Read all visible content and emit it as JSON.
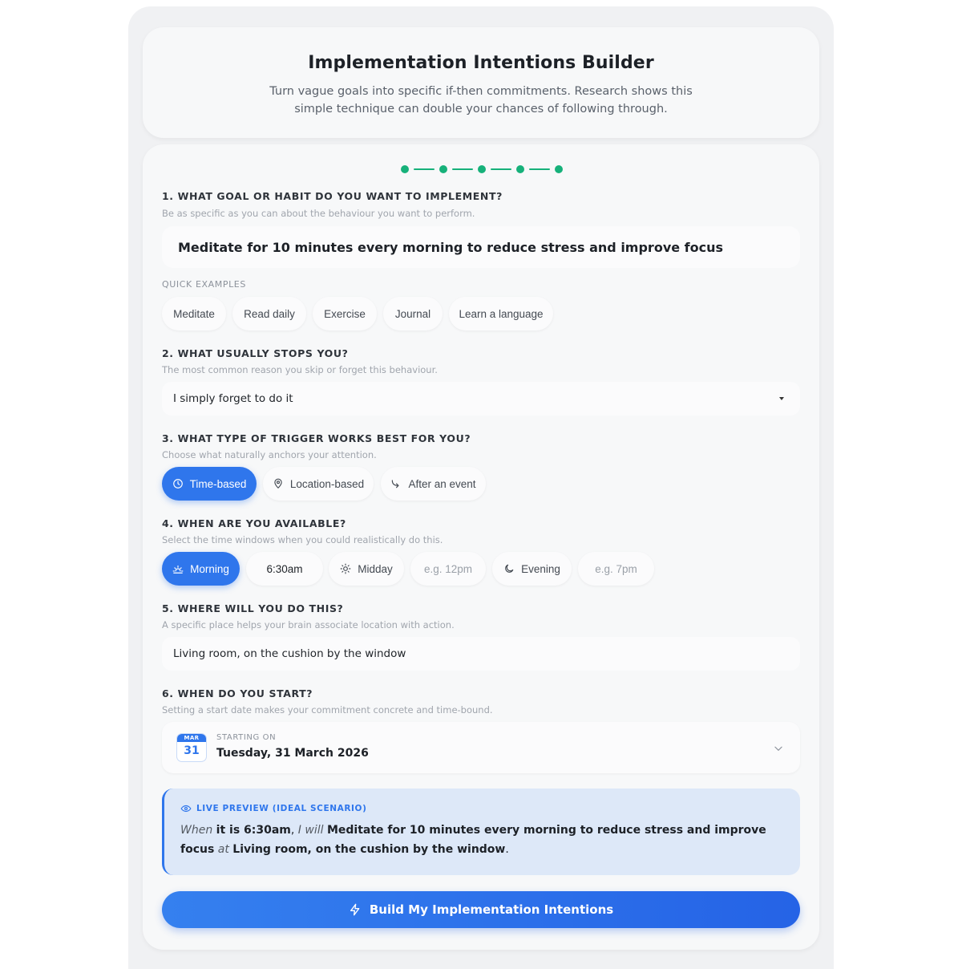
{
  "header": {
    "title": "Implementation Intentions Builder",
    "subtitle": "Turn vague goals into specific if-then commitments. Research shows this simple technique can double your chances of following through."
  },
  "stepper": {
    "steps": 5,
    "completed": 5,
    "color": "#16b17a"
  },
  "goal": {
    "label": "1. WHAT GOAL OR HABIT DO YOU WANT TO IMPLEMENT?",
    "hint": "Be as specific as you can about the behaviour you want to perform.",
    "value": "Meditate for 10 minutes every morning to reduce stress and improve focus",
    "examples_label": "QUICK EXAMPLES",
    "examples": [
      "Meditate",
      "Read daily",
      "Exercise",
      "Journal",
      "Learn a language"
    ]
  },
  "obstacle": {
    "label": "2. WHAT USUALLY STOPS YOU?",
    "hint": "The most common reason you skip or forget this behaviour.",
    "selected": "I simply forget to do it"
  },
  "trigger": {
    "label": "3. WHAT TYPE OF TRIGGER WORKS BEST FOR YOU?",
    "hint": "Choose what naturally anchors your attention.",
    "options": [
      {
        "label": "Time-based",
        "icon": "clock-icon",
        "active": true
      },
      {
        "label": "Location-based",
        "icon": "location-pin-icon",
        "active": false
      },
      {
        "label": "After an event",
        "icon": "arrow-turn-icon",
        "active": false
      }
    ]
  },
  "availability": {
    "label": "4. WHEN ARE YOU AVAILABLE?",
    "hint": "Select the time windows when you could realistically do this.",
    "morning": {
      "label": "Morning",
      "time_value": "6:30am",
      "active": true
    },
    "midday": {
      "label": "Midday",
      "time_placeholder": "e.g. 12pm",
      "active": false
    },
    "evening": {
      "label": "Evening",
      "time_placeholder": "e.g. 7pm",
      "active": false
    }
  },
  "location": {
    "label": "5. WHERE WILL YOU DO THIS?",
    "hint": "A specific place helps your brain associate location with action.",
    "value": "Living room, on the cushion by the window"
  },
  "start": {
    "label": "6. WHEN DO YOU START?",
    "hint": "Setting a start date makes your commitment concrete and time-bound.",
    "cal_month": "MAR",
    "cal_day": "31",
    "starting_label": "STARTING ON",
    "date_text": "Tuesday, 31 March 2026"
  },
  "preview": {
    "label": "LIVE PREVIEW (IDEAL SCENARIO)",
    "when_word": "When",
    "trigger_text": "it is 6:30am",
    "comma": ",",
    "will_word": "I will",
    "behaviour_text": "Meditate for 10 minutes every morning to reduce stress and improve focus",
    "at_word": "at",
    "location_text": "Living room, on the cushion by the window",
    "period": "."
  },
  "cta": {
    "label": "Build My Implementation Intentions"
  },
  "colors": {
    "accent": "#2f76ec",
    "success": "#16b17a",
    "preview_bg": "#dde8f8"
  }
}
